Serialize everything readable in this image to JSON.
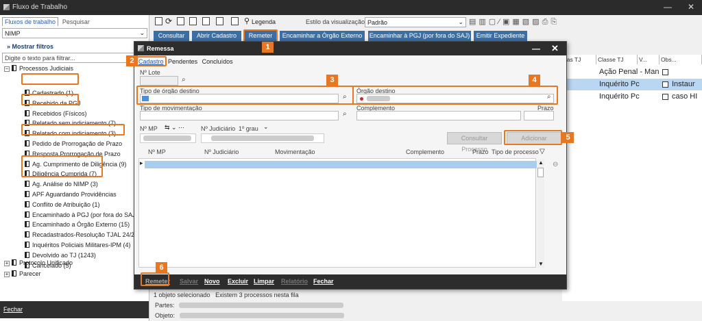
{
  "window": {
    "title": "Fluxo de Trabalho"
  },
  "left_panel": {
    "tabs": [
      "Fluxos de trabalho",
      "Pesquisar"
    ],
    "flow_select": "NIMP",
    "show_filters": "Mostrar filtros",
    "filter_placeholder": "Digite o texto para filtrar...",
    "tree_root": "Processos Judiciais",
    "tree_items": [
      "Cadastrado (1)",
      "Recebido da PGJ",
      "Recebidos (Físicos)",
      "Relatado sem indiciamento (7)",
      "Relatado com indiciamento (3)",
      "Pedido de Prorrogação de Prazo",
      "Resposta Prorrogação de Prazo",
      "Ag. Cumprimento de Diligência (9)",
      "Diligência Cumprida (7)",
      "Ag. Análise do NIMP (3)",
      "APF Aguardando Providências",
      "Conflito de Atribuição (1)",
      "Encaminhado à PGJ (por fora do SAJ)",
      "Encaminhado a Órgão Externo (15)",
      "Recadastrados-Resolução TJAL 24/20",
      "Inquéritos Policiais Militares-IPM (4)",
      "Devolvido ao TJ (1243)",
      "Cancelado (5)"
    ],
    "other_roots": [
      "Protocolo Unificado",
      "Parecer"
    ],
    "close": "Fechar"
  },
  "toolbar": {
    "legenda": "Legenda",
    "view_style_label": "Estilo da visualização",
    "view_style_value": "Padrão",
    "actions": [
      "Consultar",
      "Abrir Cadastro",
      "Remeter",
      "Encaminhar a Órgão Externo",
      "Encaminhar à PGJ (por fora do SAJ)",
      "Emitir Expediente"
    ]
  },
  "grid": {
    "headers": [
      "rjas TJ",
      "Classe TJ",
      "V...",
      "Obs..."
    ],
    "rows": [
      {
        "classe": "Ação Penal - Man",
        "obs": ""
      },
      {
        "classe": "Inquérito Pc",
        "obs": "Instaur"
      },
      {
        "classe": "Inquérito Pc",
        "obs": "caso HI"
      }
    ]
  },
  "status": {
    "selected": "1 objeto selecionado",
    "count": "Existem 3 processos nesta fila",
    "partes": "Partes:",
    "objeto": "Objeto:"
  },
  "dialog": {
    "title": "Remessa",
    "tabs": [
      "Cadastro",
      "Pendentes",
      "Concluídos"
    ],
    "lote_label": "Nº Lote",
    "tipo_orgao_label": "Tipo de órgão destino",
    "orgao_label": "Órgão destino",
    "tipo_mov_label": "Tipo de movimentação",
    "complemento_label": "Complemento",
    "prazo_label": "Prazo",
    "nmp_label": "Nº MP",
    "nj_label": "Nº Judiciário",
    "grau": "1º grau",
    "consult_btn": "Consultar Processo",
    "add_btn": "Adicionar",
    "columns": [
      "Nº MP",
      "Nº Judiciário",
      "Movimentação",
      "Complemento",
      "Prazo",
      "Tipo de processo"
    ],
    "footer": [
      "Remeter",
      "Salvar",
      "Novo",
      "Excluir",
      "Limpar",
      "Relatório",
      "Fechar"
    ]
  },
  "badges": [
    "1",
    "2",
    "3",
    "4",
    "5",
    "6"
  ],
  "colors": {
    "highlight": "#e87722",
    "action": "#3a6ea5",
    "titlebar": "#2b2b2b"
  }
}
